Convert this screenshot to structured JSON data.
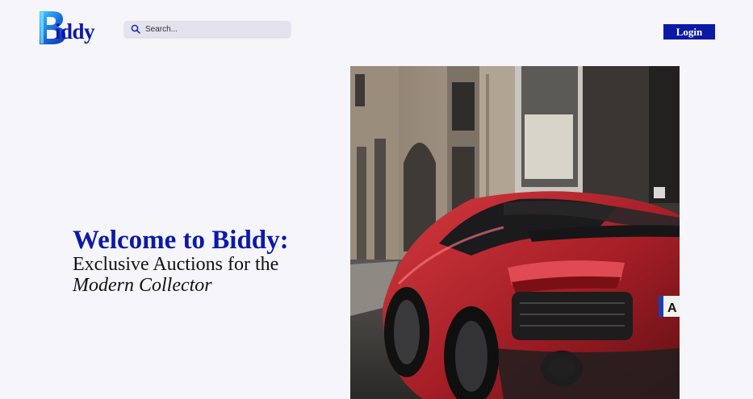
{
  "header": {
    "logo_text": "iddy",
    "logo_icon": "biddy-b-logo",
    "search": {
      "placeholder": "Search...",
      "value": "",
      "icon": "search-icon"
    },
    "login_label": "Login"
  },
  "hero": {
    "title": "Welcome to Biddy:",
    "subtitle": "Exclusive Auctions for the",
    "emphasis": "Modern Collector",
    "image": {
      "subject": "red sports car parked beside a stone building",
      "plate_text": "A"
    }
  },
  "colors": {
    "brand": "#0b1aa8",
    "background": "#f5f5fa",
    "search_bg": "#e2e3ef",
    "car_red": "#b3222a"
  }
}
